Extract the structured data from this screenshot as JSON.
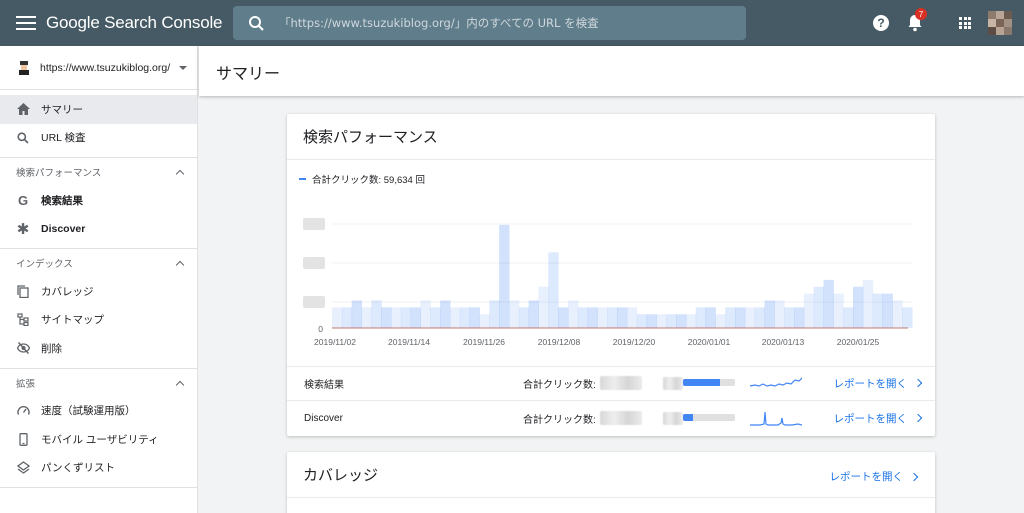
{
  "app": {
    "title": "Google Search Console"
  },
  "search": {
    "placeholder": "「https://www.tsuzukiblog.org/」内のすべての URL を検査"
  },
  "topbar": {
    "notification_count": "7",
    "help_glyph": "?"
  },
  "sidebar": {
    "property": "https://www.tsuzukiblog.org/",
    "top_items": [
      {
        "label": "サマリー",
        "icon": "home-icon",
        "active": true
      },
      {
        "label": "URL 検査",
        "icon": "search-icon",
        "active": false
      }
    ],
    "sections": [
      {
        "title": "検索パフォーマンス",
        "items": [
          {
            "label": "検索結果",
            "icon": "google-g-icon"
          },
          {
            "label": "Discover",
            "icon": "asterisk-icon"
          }
        ]
      },
      {
        "title": "インデックス",
        "items": [
          {
            "label": "カバレッジ",
            "icon": "copy-icon"
          },
          {
            "label": "サイトマップ",
            "icon": "sitemap-icon"
          },
          {
            "label": "削除",
            "icon": "eye-off-icon"
          }
        ]
      },
      {
        "title": "拡張",
        "items": [
          {
            "label": "速度（試験運用版）",
            "icon": "speedometer-icon"
          },
          {
            "label": "モバイル ユーザビリティ",
            "icon": "smartphone-icon"
          },
          {
            "label": "パンくずリスト",
            "icon": "layers-icon"
          }
        ]
      }
    ]
  },
  "page": {
    "title": "サマリー"
  },
  "performance": {
    "title": "検索パフォーマンス",
    "legend": "合計クリック数: 59,634 回",
    "rows": [
      {
        "name": "検索結果",
        "metric_label": "合計クリック数:",
        "share": 0.72,
        "link": "レポートを開く"
      },
      {
        "name": "Discover",
        "metric_label": "合計クリック数:",
        "share": 0.2,
        "link": "レポートを開く"
      }
    ]
  },
  "coverage": {
    "title": "カバレッジ",
    "link": "レポートを開く"
  },
  "chart_data": {
    "type": "bar",
    "title": "",
    "xlabel": "",
    "ylabel": "",
    "y_tick_labels": [
      "0"
    ],
    "x_tick_labels": [
      "2019/11/02",
      "2019/11/14",
      "2019/11/26",
      "2019/12/08",
      "2019/12/20",
      "2020/01/01",
      "2020/01/13",
      "2020/01/25"
    ],
    "series": [
      {
        "name": "合計クリック数",
        "values": [
          3,
          3,
          4,
          3,
          4,
          3,
          3,
          3,
          3,
          4,
          3,
          4,
          3,
          3,
          3,
          2,
          4,
          15,
          4,
          3,
          4,
          6,
          11,
          3,
          4,
          3,
          3,
          3,
          3,
          3,
          3,
          2,
          2,
          2,
          2,
          2,
          2,
          3,
          3,
          2,
          3,
          3,
          3,
          3,
          4,
          4,
          3,
          3,
          5,
          6,
          7,
          5,
          3,
          6,
          7,
          5,
          5,
          4,
          3
        ]
      }
    ],
    "color": "#4285f4",
    "grid": true
  }
}
